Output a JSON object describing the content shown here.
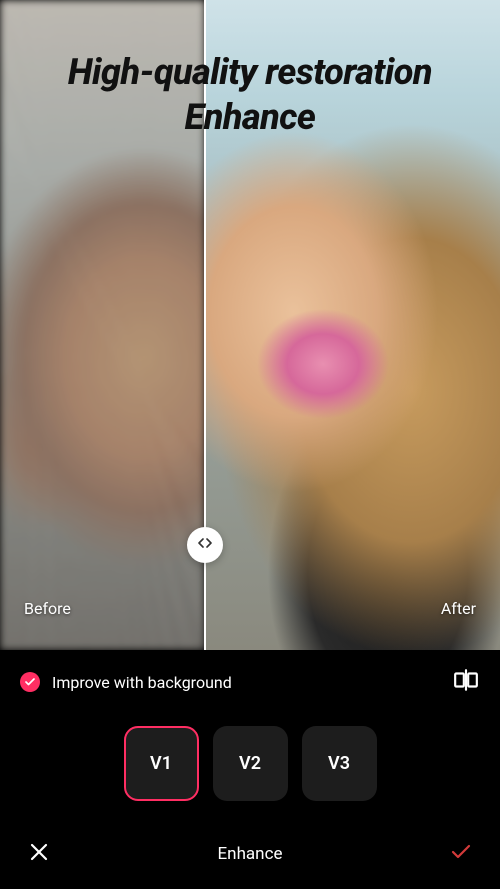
{
  "headline": "High-quality restoration Enhance",
  "preview": {
    "before_label": "Before",
    "after_label": "After",
    "slider_position_percent": 41
  },
  "option": {
    "label": "Improve with background",
    "checked": true
  },
  "versions": {
    "items": [
      {
        "label": "V1",
        "selected": true
      },
      {
        "label": "V2",
        "selected": false
      },
      {
        "label": "V3",
        "selected": false
      }
    ]
  },
  "bottom": {
    "mode_label": "Enhance"
  },
  "colors": {
    "accent": "#ff2e63",
    "confirm": "#d23a3a",
    "panel_bg": "#000000",
    "version_bg": "#1d1d1d"
  }
}
